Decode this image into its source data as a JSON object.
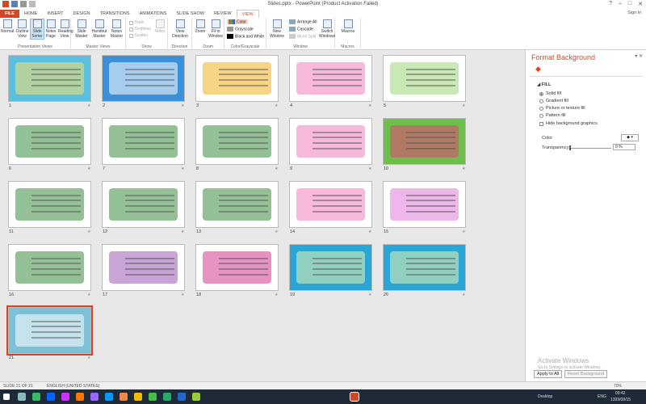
{
  "window": {
    "title": "Slides.pptx - PowerPoint (Product Activation Failed)",
    "sign_in": "Sign in"
  },
  "tabs": [
    "FILE",
    "HOME",
    "INSERT",
    "DESIGN",
    "TRANSITIONS",
    "ANIMATIONS",
    "SLIDE SHOW",
    "REVIEW",
    "VIEW"
  ],
  "active_tab": "VIEW",
  "ribbon": {
    "presentation_views": {
      "label": "Presentation Views",
      "buttons": [
        "Normal",
        "Outline View",
        "Slide Sorter",
        "Notes Page",
        "Reading View"
      ]
    },
    "master_views": {
      "label": "Master Views",
      "buttons": [
        "Slide Master",
        "Handout Master",
        "Notes Master"
      ]
    },
    "show": {
      "label": "Show",
      "items": [
        "Ruler",
        "Gridlines",
        "Guides"
      ],
      "notes": "Notes"
    },
    "direction": {
      "label": "Direction",
      "button": "View Direction"
    },
    "zoom": {
      "label": "Zoom",
      "buttons": [
        "Zoom",
        "Fit to Window"
      ]
    },
    "color": {
      "label": "Color/Grayscale",
      "items": [
        "Color",
        "Grayscale",
        "Black and White"
      ]
    },
    "window": {
      "label": "Window",
      "new": "New Window",
      "items": [
        "Arrange All",
        "Cascade",
        "Move Split"
      ],
      "switch": "Switch Windows"
    },
    "macros": {
      "label": "Macros",
      "button": "Macros"
    }
  },
  "slides": [
    {
      "num": "1",
      "bg": "#5bbfe0",
      "accent": "#f7e06b"
    },
    {
      "num": "2",
      "bg": "#3b90d8",
      "accent": "#ffffff"
    },
    {
      "num": "3",
      "bg": "#ffffff",
      "accent": "#f0b020"
    },
    {
      "num": "4",
      "bg": "#ffffff",
      "accent": "#f07dbf"
    },
    {
      "num": "5",
      "bg": "#ffffff",
      "accent": "#9ed37a"
    },
    {
      "num": "6",
      "bg": "#ffffff",
      "accent": "#3c8d3f"
    },
    {
      "num": "7",
      "bg": "#ffffff",
      "accent": "#3c8d3f"
    },
    {
      "num": "8",
      "bg": "#ffffff",
      "accent": "#3c8d3f"
    },
    {
      "num": "9",
      "bg": "#ffffff",
      "accent": "#f07dbf"
    },
    {
      "num": "10",
      "bg": "#6cbf4a",
      "accent": "#e8407a"
    },
    {
      "num": "11",
      "bg": "#ffffff",
      "accent": "#3c8d3f"
    },
    {
      "num": "12",
      "bg": "#ffffff",
      "accent": "#3c8d3f"
    },
    {
      "num": "13",
      "bg": "#ffffff",
      "accent": "#3c8d3f"
    },
    {
      "num": "14",
      "bg": "#ffffff",
      "accent": "#f07dbf"
    },
    {
      "num": "15",
      "bg": "#ffffff",
      "accent": "#e07bd8"
    },
    {
      "num": "16",
      "bg": "#ffffff",
      "accent": "#3c8d3f"
    },
    {
      "num": "17",
      "bg": "#ffffff",
      "accent": "#9b59b6"
    },
    {
      "num": "18",
      "bg": "#ffffff",
      "accent": "#d33a8f"
    },
    {
      "num": "19",
      "bg": "#2aa6d6",
      "accent": "#e6f3b0"
    },
    {
      "num": "20",
      "bg": "#2aa6d6",
      "accent": "#e6f3b0"
    },
    {
      "num": "21",
      "bg": "#7ec0d8",
      "accent": "#ffffff"
    }
  ],
  "panel": {
    "title": "Format Background",
    "section": "FILL",
    "options": [
      "Solid fill",
      "Gradient fill",
      "Picture or texture fill",
      "Pattern fill"
    ],
    "selected_option": "Solid fill",
    "hide_graphics": "Hide background graphics",
    "color_label": "Color",
    "transparency_label": "Transparency",
    "transparency_value": "0 %",
    "apply_all": "Apply to All",
    "reset": "Reset Background"
  },
  "watermark": {
    "title": "Activate Windows",
    "sub": "Go to Settings to activate Windows."
  },
  "status": {
    "slide": "SLIDE 21 OF 21",
    "language": "ENGLISH (UNITED STATES)",
    "zoom": "70%"
  },
  "taskbar": {
    "desktop": "Desktop",
    "lang": "ENG",
    "time": "09:42",
    "date": "1399/08/15"
  }
}
